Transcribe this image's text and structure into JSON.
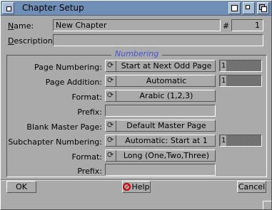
{
  "window": {
    "title": "Chapter Setup"
  },
  "top": {
    "name_label": "Name:",
    "name_value": "New Chapter",
    "number_label": "#",
    "number_value": "1",
    "description_label": "Description:",
    "description_value": ""
  },
  "group": {
    "title": "Numbering",
    "page_numbering": {
      "label": "Page Numbering:",
      "value": "Start at Next Odd Page",
      "number": "1"
    },
    "page_addition": {
      "label": "Page Addition:",
      "value": "Automatic",
      "number": "1"
    },
    "format1": {
      "label": "Format:",
      "value": "Arabic (1,2,3)"
    },
    "prefix1": {
      "label": "Prefix:",
      "value": ""
    },
    "blank_master": {
      "label": "Blank Master Page:",
      "value": "Default Master Page"
    },
    "subchapter": {
      "label": "Subchapter Numbering:",
      "value": "Automatic: Start at 1",
      "number": "1"
    },
    "format2": {
      "label": "Format:",
      "value": "Long (One,Two,Three)"
    },
    "prefix2": {
      "label": "Prefix:",
      "value": ""
    }
  },
  "buttons": {
    "ok": "OK",
    "help": "Help",
    "cancel": "Cancel"
  },
  "icons": {
    "close": "close-icon",
    "cycle": "cycle-icon",
    "help": "help-icon",
    "zoom": "zoom-icon",
    "iconify": "iconify-icon",
    "depth": "depth-icon"
  },
  "colors": {
    "background": "#aaaaaa",
    "titlebar": "#6f8fb7",
    "group_title": "#3a55d6",
    "help_icon": "#cc0000"
  }
}
